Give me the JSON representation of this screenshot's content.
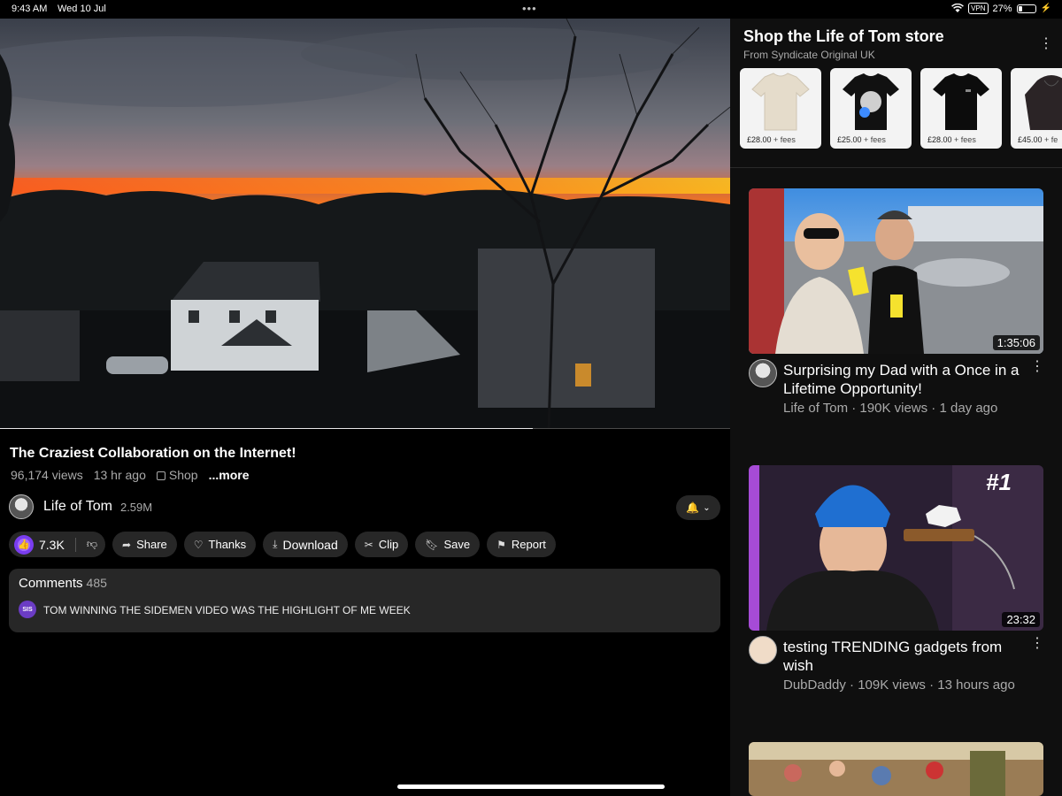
{
  "status_bar": {
    "time": "9:43 AM",
    "date": "Wed 10 Jul",
    "vpn": "VPN",
    "battery": "27%",
    "battery_fraction": 0.27
  },
  "player": {
    "progress_fraction": 0.73
  },
  "video": {
    "title": "The Craziest Collaboration on the Internet!",
    "views": "96,174 views",
    "age": "13 hr ago",
    "shop_label": "Shop",
    "more_label": "...more"
  },
  "channel": {
    "name": "Life of Tom",
    "subscribers": "2.59M"
  },
  "actions": {
    "like_count": "7.3K",
    "share": "Share",
    "thanks": "Thanks",
    "download": "Download",
    "clip": "Clip",
    "save": "Save",
    "report": "Report"
  },
  "comments": {
    "label": "Comments",
    "count": "485",
    "avatar_text": "SIS",
    "top_comment": "TOM WINNING THE SIDEMEN VIDEO WAS THE HIGHLIGHT OF ME WEEK"
  },
  "store": {
    "title": "Shop the Life of Tom store",
    "subtitle": "From Syndicate Original UK",
    "products": [
      {
        "price": "£28.00",
        "fees": "+ fees"
      },
      {
        "price": "£25.00",
        "fees": "+ fees"
      },
      {
        "price": "£28.00",
        "fees": "+ fees"
      },
      {
        "price": "£45.00",
        "fees": "+ fe"
      }
    ]
  },
  "recommendations": [
    {
      "title": "Surprising my Dad with a Once in a Lifetime Opportunity!",
      "meta": "Life of Tom · 190K views · 1 day ago",
      "duration": "1:35:06"
    },
    {
      "title": "testing TRENDING gadgets from wish",
      "meta": "DubDaddy · 109K views · 13 hours ago",
      "duration": "23:32",
      "thumb_badge": "#1"
    }
  ]
}
